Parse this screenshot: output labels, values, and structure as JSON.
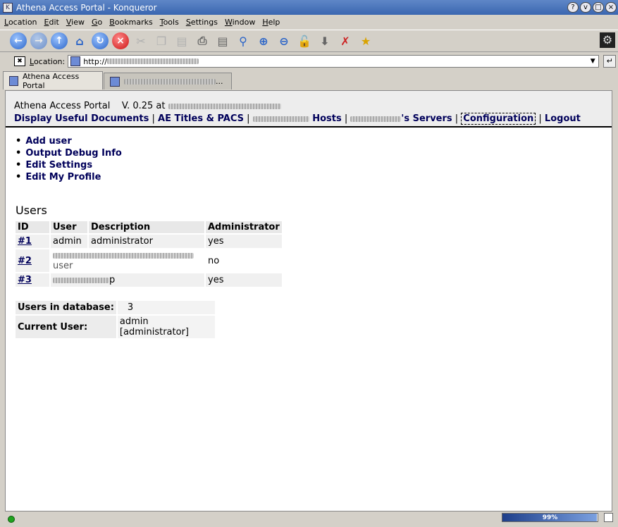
{
  "window": {
    "title": "Athena Access Portal - Konqueror",
    "buttons": [
      "?",
      "v",
      "□",
      "×"
    ]
  },
  "menubar": [
    "Location",
    "Edit",
    "View",
    "Go",
    "Bookmarks",
    "Tools",
    "Settings",
    "Window",
    "Help"
  ],
  "toolbar": {
    "icons": [
      "back-icon",
      "forward-icon",
      "up-icon",
      "home-icon",
      "reload-icon",
      "stop-icon",
      "cut-icon",
      "copy-icon",
      "paste-icon",
      "print-icon",
      "print-frame-icon",
      "zoom-icon",
      "zoom-in-icon",
      "zoom-out-icon",
      "lock-icon",
      "download-icon",
      "security-icon",
      "bookmark-icon"
    ]
  },
  "location": {
    "label": "Location:",
    "url": "http://"
  },
  "tabs": [
    {
      "label": "Athena Access Portal"
    },
    {
      "label": "..."
    }
  ],
  "page": {
    "app_name": "Athena Access Portal",
    "version": "V. 0.25 at",
    "nav": [
      {
        "label": "Display Useful Documents"
      },
      {
        "label": "AE Titles & PACS"
      },
      {
        "label": "Hosts"
      },
      {
        "label": "'s Servers"
      },
      {
        "label": "Configuration"
      },
      {
        "label": "Logout"
      }
    ],
    "actions": [
      "Add user",
      "Output Debug Info",
      "Edit Settings",
      "Edit My Profile"
    ],
    "users_heading": "Users",
    "table": {
      "headers": [
        "ID",
        "User",
        "Description",
        "Administrator"
      ],
      "rows": [
        {
          "id": "#1",
          "user": "admin",
          "description": "administrator",
          "admin": "yes"
        },
        {
          "id": "#2",
          "user": "",
          "description": "user",
          "admin": "no"
        },
        {
          "id": "#3",
          "user": "p",
          "description": "",
          "admin": "yes"
        }
      ]
    },
    "stats": {
      "users_in_db_label": "Users in database:",
      "users_in_db_value": "3",
      "current_user_label": "Current User:",
      "current_user_value": "admin [administrator]"
    }
  },
  "status": {
    "progress_percent": 99,
    "progress_text": "99%"
  }
}
